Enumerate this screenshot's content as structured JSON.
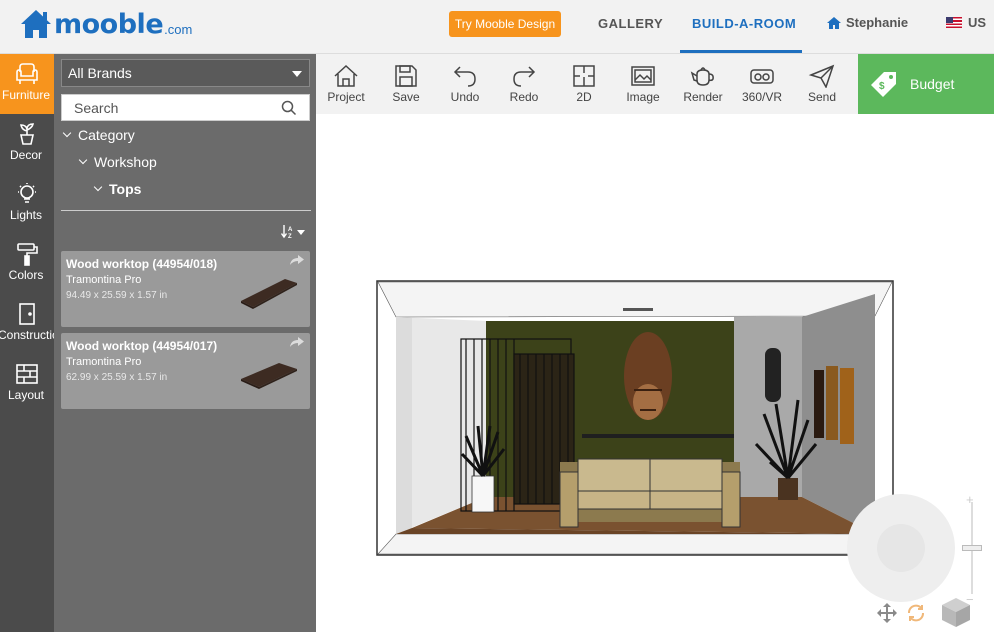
{
  "header": {
    "logo_text": "mooble",
    "logo_suffix": ".com",
    "try_button": "Try Mooble Design",
    "nav": [
      {
        "label": "GALLERY"
      },
      {
        "label": "BUILD-A-ROOM"
      }
    ],
    "user_name": "Stephanie",
    "locale": "US",
    "accent_color": "#1e6fbf",
    "cta_color": "#f7941d"
  },
  "rail": {
    "items": [
      {
        "label": "Furniture",
        "icon": "armchair-icon",
        "active": true
      },
      {
        "label": "Decor",
        "icon": "plant-pot-icon"
      },
      {
        "label": "Lights",
        "icon": "lightbulb-icon"
      },
      {
        "label": "Colors",
        "icon": "paint-roller-icon"
      },
      {
        "label": "Construction",
        "icon": "door-icon"
      },
      {
        "label": "Layout",
        "icon": "floor-tiles-icon"
      }
    ]
  },
  "catalog": {
    "brand_select": "All Brands",
    "search_placeholder": "Search",
    "tree": [
      {
        "label": "Category"
      },
      {
        "label": "Workshop"
      },
      {
        "label": "Tops"
      }
    ],
    "products": [
      {
        "title": "Wood worktop (44954/018)",
        "brand": "Tramontina Pro",
        "dims": "94.49 x 25.59 x 1.57 in"
      },
      {
        "title": "Wood worktop (44954/017)",
        "brand": "Tramontina Pro",
        "dims": "62.99 x 25.59 x 1.57 in"
      }
    ]
  },
  "toolbar": {
    "tools": [
      {
        "label": "Project",
        "icon": "house-icon"
      },
      {
        "label": "Save",
        "icon": "floppy-disk-icon"
      },
      {
        "label": "Undo",
        "icon": "undo-arrow-icon"
      },
      {
        "label": "Redo",
        "icon": "redo-arrow-icon"
      },
      {
        "label": "2D",
        "icon": "floor-plan-icon"
      },
      {
        "label": "Image",
        "icon": "picture-icon"
      },
      {
        "label": "Render",
        "icon": "teapot-icon"
      },
      {
        "label": "360/VR",
        "icon": "vr-headset-icon"
      },
      {
        "label": "Send",
        "icon": "paper-plane-icon"
      }
    ],
    "budget_label": "Budget",
    "budget_color": "#5cb85c"
  }
}
